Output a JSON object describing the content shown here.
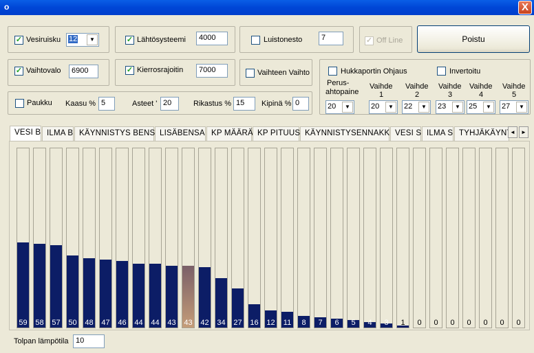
{
  "window": {
    "title": "o",
    "close_label": "X"
  },
  "row1": {
    "vesiruisku": {
      "label": "Vesiruisku",
      "checked": true,
      "value": "12"
    },
    "lahtosysteemi": {
      "label": "Lähtösysteemi",
      "checked": true,
      "value": "4000"
    },
    "luistonesto": {
      "label": "Luistonesto",
      "checked": false,
      "value": "7"
    },
    "offline": {
      "label": "Off Line",
      "checked": true
    },
    "poistu_label": "Poistu"
  },
  "row2": {
    "vaihtovalo": {
      "label": "Vaihtovalo",
      "checked": true,
      "value": "6900"
    },
    "kierrosrajoitin": {
      "label": "Kierrosrajoitin",
      "checked": true,
      "value": "7000"
    },
    "vaihteen_vaihto": {
      "label": "Vaihteen Vaihto",
      "checked": false
    }
  },
  "row3": {
    "paukku": {
      "label": "Paukku",
      "checked": false
    },
    "kaasu": {
      "label": "Kaasu %",
      "value": "5"
    },
    "asteet": {
      "label": "Asteet '",
      "value": "20"
    },
    "rikastus": {
      "label": "Rikastus %",
      "value": "15"
    },
    "kipina": {
      "label": "Kipinä %",
      "value": "0"
    }
  },
  "hukkaportti": {
    "ohjaus_label": "Hukkaportin Ohjaus",
    "ohjaus_checked": false,
    "invertoitu_label": "Invertoitu",
    "invertoitu_checked": false,
    "perus_label_1": "Perus-",
    "perus_label_2": "ahtopaine",
    "perus_value": "20",
    "gears": [
      {
        "label_1": "Vaihde",
        "label_2": "1",
        "value": "20"
      },
      {
        "label_1": "Vaihde",
        "label_2": "2",
        "value": "22"
      },
      {
        "label_1": "Vaihde",
        "label_2": "3",
        "value": "23"
      },
      {
        "label_1": "Vaihde",
        "label_2": "4",
        "value": "25"
      },
      {
        "label_1": "Vaihde",
        "label_2": "5",
        "value": "27"
      }
    ]
  },
  "tabs": [
    "VESI B",
    "ILMA B",
    "KÄYNNISTYS BENSA",
    "LISÄBENSA",
    "KP MÄÄRÄ",
    "KP PITUUS",
    "KÄYNNISTYSENNAKKO",
    "VESI S",
    "ILMA S",
    "TYHJÄKÄYNTI"
  ],
  "active_tab": 0,
  "scroll_left": "◄",
  "scroll_right": "►",
  "columns": [
    59,
    58,
    57,
    50,
    48,
    47,
    46,
    44,
    44,
    43,
    43,
    42,
    34,
    27,
    16,
    12,
    11,
    8,
    7,
    6,
    5,
    4,
    3,
    1,
    0,
    0,
    0,
    0,
    0,
    0,
    0
  ],
  "highlight_index": 10,
  "column_max": 125,
  "colors": {
    "bar": "#0c1d66",
    "highlight_top": "#7a5f68",
    "highlight_bottom": "#c59d78"
  },
  "tolpan": {
    "label": "Tolpan lämpötila",
    "value": "10"
  }
}
